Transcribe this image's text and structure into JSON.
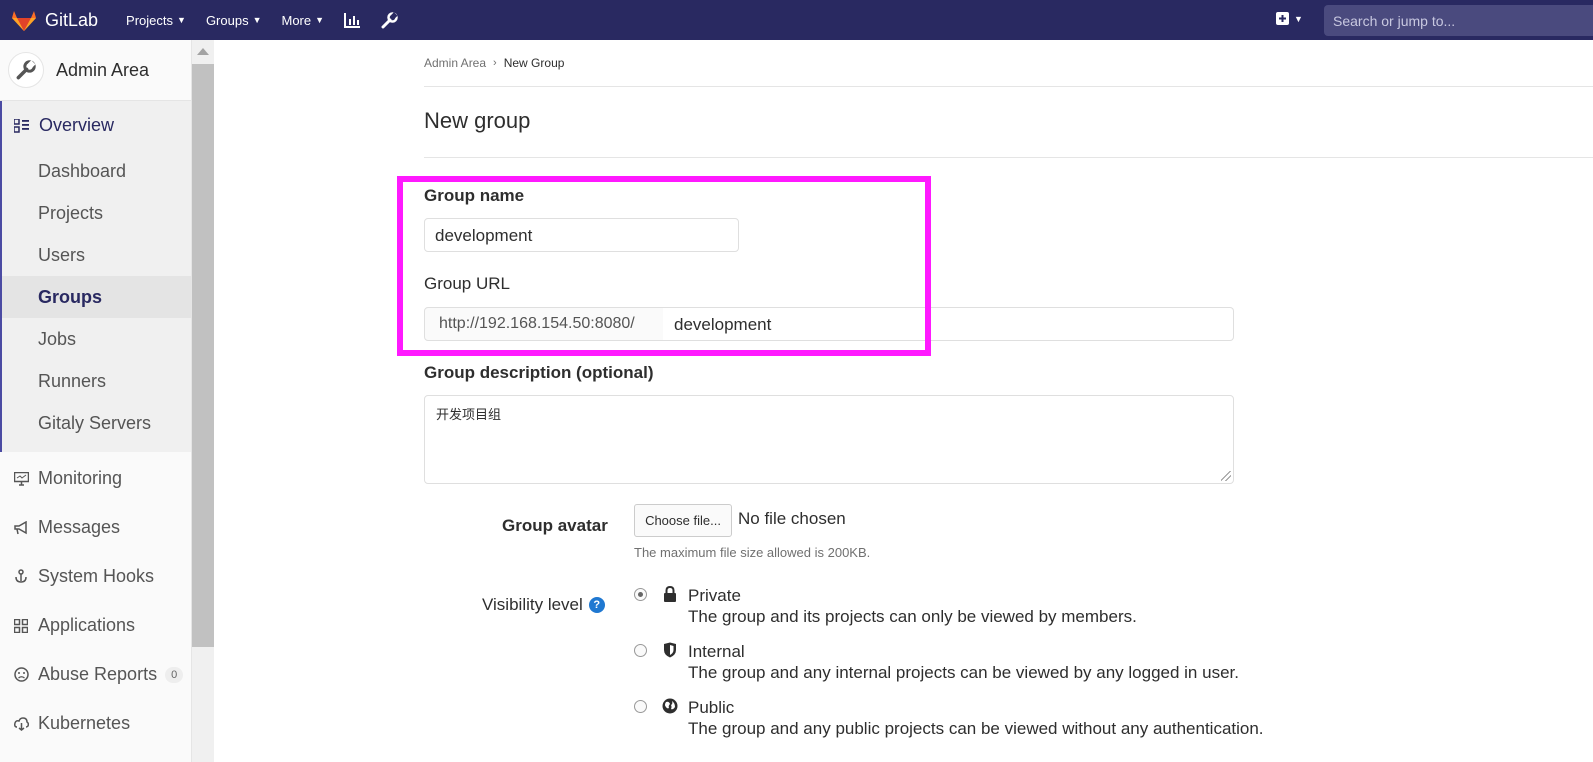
{
  "topnav": {
    "brand": "GitLab",
    "menus": [
      "Projects",
      "Groups",
      "More"
    ],
    "search_placeholder": "Search or jump to...",
    "colors": {
      "bg": "#292961",
      "logo": "#fc6d26"
    }
  },
  "sidebar": {
    "header": "Admin Area",
    "overview": "Overview",
    "overview_items": [
      "Dashboard",
      "Projects",
      "Users",
      "Groups",
      "Jobs",
      "Runners",
      "Gitaly Servers"
    ],
    "active_item": "Groups",
    "items": [
      {
        "label": "Monitoring",
        "icon": "monitor-icon"
      },
      {
        "label": "Messages",
        "icon": "megaphone-icon"
      },
      {
        "label": "System Hooks",
        "icon": "hook-icon"
      },
      {
        "label": "Applications",
        "icon": "applications-icon"
      },
      {
        "label": "Abuse Reports",
        "icon": "abuse-icon",
        "badge": "0"
      },
      {
        "label": "Kubernetes",
        "icon": "kubernetes-icon"
      }
    ]
  },
  "breadcrumb": {
    "parent": "Admin Area",
    "current": "New Group"
  },
  "page": {
    "title": "New group"
  },
  "form": {
    "group_name_label": "Group name",
    "group_name_value": "development",
    "group_url_label": "Group URL",
    "group_url_prefix": "http://192.168.154.50:8080/",
    "group_url_path": "development",
    "description_label": "Group description (optional)",
    "description_value": "开发项目组",
    "avatar_label": "Group avatar",
    "choose_file": "Choose file...",
    "no_file": "No file chosen",
    "avatar_help": "The maximum file size allowed is 200KB.",
    "visibility_label": "Visibility level",
    "visibility_options": [
      {
        "title": "Private",
        "desc": "The group and its projects can only be viewed by members.",
        "checked": true,
        "icon": "lock-icon"
      },
      {
        "title": "Internal",
        "desc": "The group and any internal projects can be viewed by any logged in user.",
        "checked": false,
        "icon": "shield-icon"
      },
      {
        "title": "Public",
        "desc": "The group and any public projects can be viewed without any authentication.",
        "checked": false,
        "icon": "globe-icon"
      }
    ]
  },
  "annotation": {
    "highlight_color": "#ff19ff"
  }
}
